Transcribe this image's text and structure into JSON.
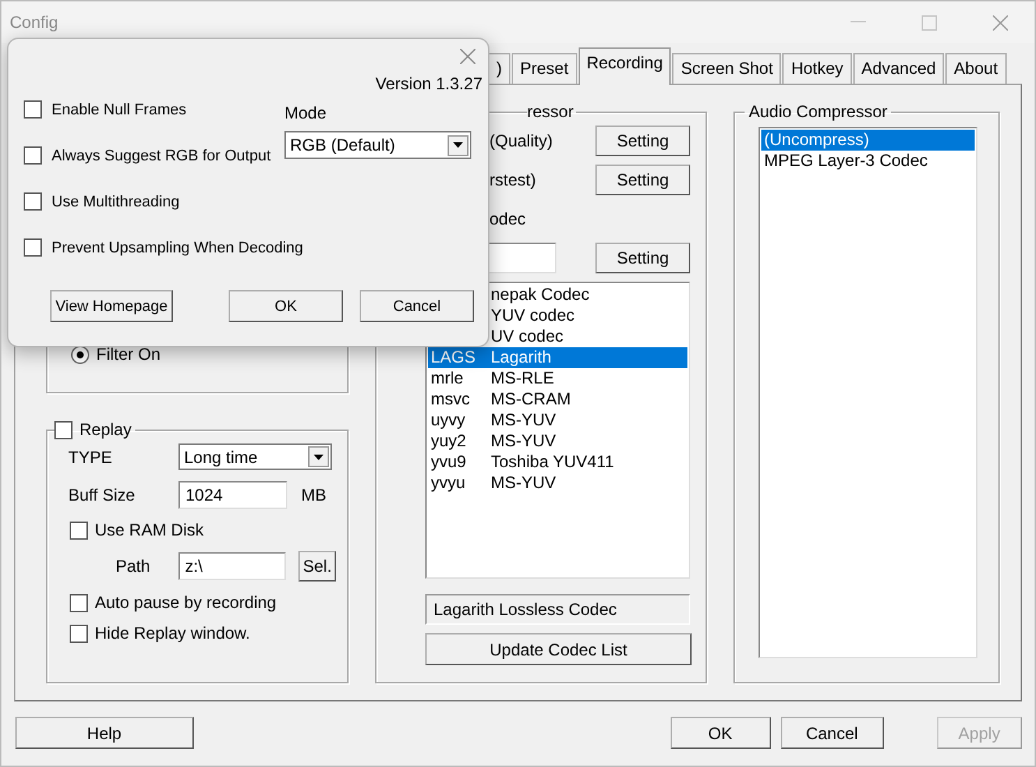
{
  "window": {
    "title": "Config"
  },
  "tabs": [
    {
      "label": ")",
      "selected": false
    },
    {
      "label": "Preset",
      "selected": false
    },
    {
      "label": "Recording",
      "selected": true
    },
    {
      "label": "Screen Shot",
      "selected": false
    },
    {
      "label": "Hotkey",
      "selected": false
    },
    {
      "label": "Advanced",
      "selected": false
    },
    {
      "label": "About",
      "selected": false
    }
  ],
  "filter": {
    "label": "Filter On",
    "selected": true
  },
  "replay": {
    "label": "Replay",
    "checked": false,
    "type_label": "TYPE",
    "type_value": "Long time",
    "buff_label": "Buff Size",
    "buff_value": "1024",
    "buff_unit": "MB",
    "ram_disk": {
      "label": "Use RAM Disk",
      "checked": false
    },
    "path_label": "Path",
    "path_value": "z:\\",
    "select_button": "Sel.",
    "options": [
      {
        "label": "Auto pause by recording",
        "checked": false
      },
      {
        "label": "Hide Replay window.",
        "checked": false
      }
    ]
  },
  "video_compressor": {
    "title": "ressor",
    "rows": [
      {
        "label": "(Quality)",
        "button": "Setting"
      },
      {
        "label": "rstest)",
        "button": "Setting"
      }
    ],
    "codec_label": "odec",
    "field_button": "Setting",
    "codecs": [
      {
        "name": "nepak Codec",
        "selected": false
      },
      {
        "name": "YUV codec",
        "selected": false
      },
      {
        "name": "UV codec",
        "selected": false
      },
      {
        "code": "LAGS",
        "name": "Lagarith",
        "selected": true
      },
      {
        "code": "mrle",
        "name": "MS-RLE",
        "selected": false
      },
      {
        "code": "msvc",
        "name": "MS-CRAM",
        "selected": false
      },
      {
        "code": "uyvy",
        "name": "MS-YUV",
        "selected": false
      },
      {
        "code": "yuy2",
        "name": "MS-YUV",
        "selected": false
      },
      {
        "code": "yvu9",
        "name": "Toshiba YUV411",
        "selected": false
      },
      {
        "code": "yvyu",
        "name": "MS-YUV",
        "selected": false
      }
    ],
    "info": "Lagarith Lossless Codec",
    "update_button": "Update Codec List"
  },
  "audio_compressor": {
    "title": "Audio Compressor",
    "items": [
      {
        "label": "(Uncompress)",
        "selected": true
      },
      {
        "label": "MPEG Layer-3 Codec",
        "selected": false
      }
    ]
  },
  "footer": [
    {
      "label": "Help",
      "disabled": false
    },
    {
      "label": "OK",
      "disabled": false
    },
    {
      "label": "Cancel",
      "disabled": false
    },
    {
      "label": "Apply",
      "disabled": true
    }
  ],
  "popup": {
    "version": "Version 1.3.27",
    "options": [
      {
        "label": "Enable Null Frames",
        "checked": false
      },
      {
        "label": "Always Suggest RGB for Output",
        "checked": false
      },
      {
        "label": "Use Multithreading",
        "checked": false
      },
      {
        "label": "Prevent Upsampling When Decoding",
        "checked": false
      }
    ],
    "mode_label": "Mode",
    "mode_value": "RGB (Default)",
    "buttons": [
      "View Homepage",
      "OK",
      "Cancel"
    ]
  }
}
